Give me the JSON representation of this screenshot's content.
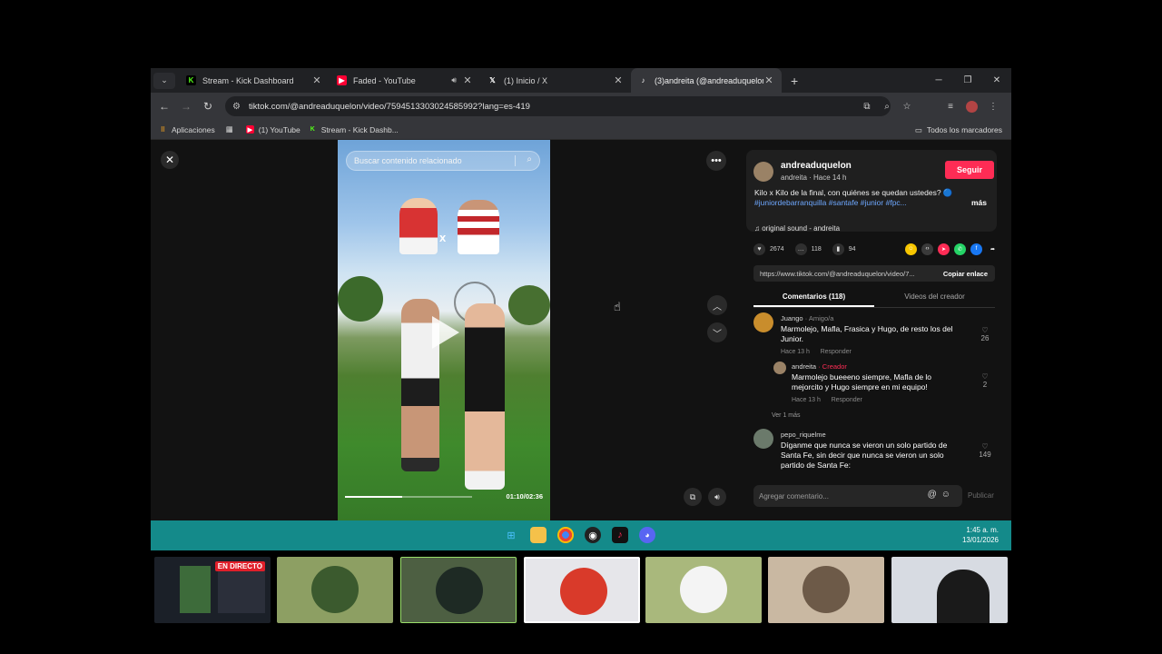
{
  "browser": {
    "tabs": [
      {
        "title": "Stream - Kick Dashboard",
        "icon": "kick-icon",
        "color": "#53fc18"
      },
      {
        "title": "Faded - YouTube",
        "icon": "youtube-icon",
        "color": "#ff0033",
        "audio": true
      },
      {
        "title": "(1) Inicio / X",
        "icon": "x-icon",
        "color": "#ffffff"
      },
      {
        "title": "(3)andreita (@andreaduquelon)",
        "icon": "tiktok-icon",
        "color": "#ffffff",
        "active": true
      }
    ],
    "url": "tiktok.com/@andreaduquelon/video/7594513303024585992?lang=es-419",
    "bookmarks": [
      {
        "label": "Aplicaciones",
        "icon": "apps-grid-icon"
      },
      {
        "label": "(1) YouTube",
        "icon": "youtube-icon"
      },
      {
        "label": "Stream - Kick Dashb...",
        "icon": "kick-icon"
      }
    ],
    "all_bookmarks": "Todos los marcadores"
  },
  "video": {
    "search_placeholder": "Buscar contenido relacionado",
    "vs_label": "x",
    "time": "01:10/02:36",
    "progress_fraction": 0.45
  },
  "post": {
    "username": "andreaduquelon",
    "subline": "andreita · Hace 14 h",
    "follow_label": "Seguir",
    "description": "Kilo x Kilo de la final, con quiénes se quedan ustedes? 🔵",
    "hashtags": "#juniordebarranquilla #santafe #junior #fpc...",
    "more_label": "más",
    "sound": "original sound - andreita",
    "likes": "2674",
    "comments_count": "118",
    "saves": "94",
    "link": "https://www.tiktok.com/@andreaduquelon/video/7...",
    "copy_label": "Copiar enlace",
    "tab_comments": "Comentarios (118)",
    "tab_creator": "Videos del creador"
  },
  "comments": [
    {
      "name": "Juango",
      "role": " · Amigo/a",
      "text": "Marmolejo, Mafla, Frasica y Hugo, de resto los del Junior.",
      "time": "Hace 13 h",
      "reply": "Responder",
      "likes": "26"
    },
    {
      "name": "andreita",
      "role": " · Creador",
      "text": "Marmolejo bueeeno siempre, Mafla de lo mejorcito y Hugo siempre en mi equipo!",
      "time": "Hace 13 h",
      "reply": "Responder",
      "likes": "2"
    },
    {
      "name": "pepo_riquelme",
      "role": "",
      "text": "Díganme que nunca se vieron un solo partido de Santa Fe, sin decir que nunca se vieron un solo partido de Santa Fe:",
      "likes": "149"
    }
  ],
  "ver_mas": "Ver 1 más",
  "add_comment_placeholder": "Agregar comentario...",
  "publish_label": "Publicar",
  "taskbar": {
    "time": "1:45 a. m.",
    "date": "13/01/2026"
  },
  "call": {
    "live_label": "EN DIRECTO"
  }
}
